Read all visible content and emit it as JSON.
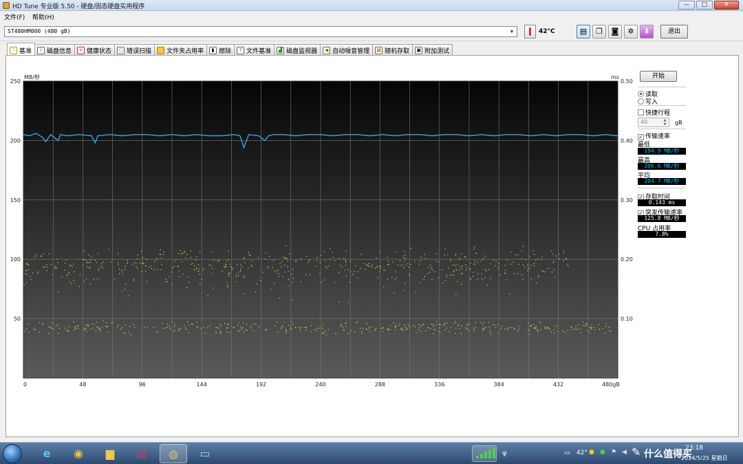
{
  "window": {
    "title": "HD Tune 专业版 5.50 - 硬盘/固态硬盘实用程序",
    "buttons": {
      "minimize": "—",
      "maximize": "□",
      "close": "✕"
    }
  },
  "menu": {
    "file": "文件(F)",
    "help": "帮助(H)"
  },
  "toolbar": {
    "drive": "ST480HM000  (480 gB)",
    "temperature": "42°C",
    "exit_label": "退出",
    "icons": [
      "copy-text-icon",
      "copy-screen-icon",
      "camera-icon",
      "options-icon",
      "save-icon"
    ]
  },
  "tabs": [
    {
      "label": "基准",
      "icon": "benchmark-icon",
      "active": true
    },
    {
      "label": "磁盘信息",
      "icon": "info-icon"
    },
    {
      "label": "健康状态",
      "icon": "health-cross-icon"
    },
    {
      "label": "错误扫描",
      "icon": "magnifier-icon"
    },
    {
      "label": "文件夹占用率",
      "icon": "folder-icon"
    },
    {
      "label": "擦除",
      "icon": "erase-icon"
    },
    {
      "label": "文件基准",
      "icon": "file-bench-icon"
    },
    {
      "label": "磁盘监视器",
      "icon": "monitor-icon"
    },
    {
      "label": "自动噪音管理",
      "icon": "speaker-icon"
    },
    {
      "label": "随机存取",
      "icon": "random-access-icon"
    },
    {
      "label": "附加测试",
      "icon": "extra-tests-icon"
    }
  ],
  "panel": {
    "start_label": "开始",
    "read_label": "读取",
    "write_label": "写入",
    "short_stroke_label": "快捷行程",
    "short_stroke_value": "40",
    "short_stroke_unit": "gB",
    "transfer_rate_label": "传输速率",
    "min_label": "最低",
    "min_value": "194.9 MB/秒",
    "max_label": "最高",
    "max_value": "206.6 MB/秒",
    "avg_label": "平均",
    "avg_value": "204.7 MB/秒",
    "access_time_label": "存取时间",
    "access_time_value": "0.143 ms",
    "burst_rate_label": "突发传输速率",
    "burst_rate_value": "125.8 MB/秒",
    "cpu_label": "CPU 占用率",
    "cpu_value": "7.8%"
  },
  "chart_data": {
    "type": "line",
    "y_left_label": "MB/秒",
    "y_right_label": "ms",
    "x_unit": "gB",
    "xlim": [
      0,
      480
    ],
    "ylim_left": [
      0,
      250
    ],
    "ylim_right": [
      0,
      0.5
    ],
    "x_ticks": [
      "0",
      "48",
      "96",
      "144",
      "192",
      "240",
      "288",
      "336",
      "384",
      "432",
      "480gB"
    ],
    "y_left_ticks": [
      "250",
      "200",
      "150",
      "100",
      "50"
    ],
    "y_right_ticks": [
      "0.50",
      "0.40",
      "0.30",
      "0.20",
      "0.10"
    ],
    "grid": true,
    "series": [
      {
        "kind": "line",
        "color": "#2fa8e0",
        "x": [
          0,
          5,
          10,
          15,
          18,
          22,
          28,
          30,
          35,
          45,
          55,
          58,
          60,
          70,
          80,
          90,
          100,
          110,
          120,
          130,
          140,
          150,
          160,
          170,
          175,
          178,
          182,
          190,
          195,
          198,
          202,
          210,
          220,
          230,
          240,
          250,
          260,
          270,
          280,
          290,
          300,
          310,
          320,
          330,
          340,
          350,
          360,
          370,
          380,
          390,
          400,
          410,
          420,
          430,
          440,
          450,
          460,
          470,
          480
        ],
        "y": [
          205,
          204,
          206,
          203,
          199,
          205,
          200,
          205,
          204,
          205,
          204,
          198,
          204,
          205,
          204,
          205,
          205,
          204,
          205,
          204,
          205,
          204,
          204,
          205,
          204,
          194,
          205,
          204,
          200,
          204,
          205,
          205,
          204,
          205,
          205,
          204,
          205,
          205,
          204,
          205,
          204,
          205,
          205,
          204,
          205,
          205,
          204,
          205,
          204,
          205,
          205,
          204,
          205,
          204,
          205,
          205,
          204,
          205,
          204
        ]
      },
      {
        "kind": "scatter",
        "color": "#d8d84a",
        "axis": "right",
        "clusters": [
          {
            "x_range": [
              0,
              440
            ],
            "y_center": 0.19,
            "y_spread": 0.035,
            "count": 520
          },
          {
            "x_range": [
              0,
              475
            ],
            "y_center": 0.085,
            "y_spread": 0.012,
            "count": 420
          },
          {
            "x_range": [
              20,
              400
            ],
            "y_center": 0.155,
            "y_spread": 0.03,
            "count": 40
          }
        ]
      }
    ]
  },
  "taskbar": {
    "items": [
      "start-orb",
      "ie-icon",
      "chrome-icon",
      "explorer-icon",
      "winrar-icon",
      "hdtune-icon",
      "photo-viewer-icon"
    ],
    "tray_temp": "42°",
    "time": "23:18",
    "date": "2014/5/25 星期日",
    "watermark": "什么值得买"
  }
}
